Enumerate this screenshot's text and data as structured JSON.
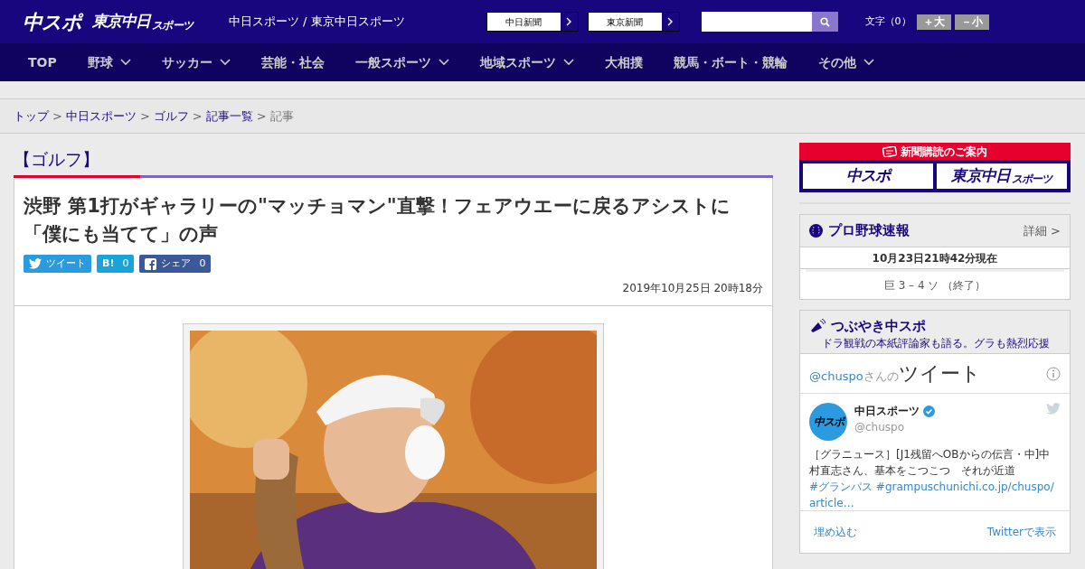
{
  "header": {
    "logo_main": "中スポ",
    "logo_tokyo": "東京中日",
    "logo_tokyo_sub": "スポーツ",
    "site_title": "中日スポーツ / 東京中日スポーツ",
    "paper_links": [
      "中日新聞",
      "東京新聞"
    ],
    "font_size_label": "文字（0）",
    "font_buttons": [
      "＋大",
      "－小"
    ]
  },
  "nav": [
    {
      "label": "TOP",
      "dropdown": false
    },
    {
      "label": "野球",
      "dropdown": true
    },
    {
      "label": "サッカー",
      "dropdown": true
    },
    {
      "label": "芸能・社会",
      "dropdown": false
    },
    {
      "label": "一般スポーツ",
      "dropdown": true
    },
    {
      "label": "地域スポーツ",
      "dropdown": true
    },
    {
      "label": "大相撲",
      "dropdown": false
    },
    {
      "label": "競馬・ボート・競輪",
      "dropdown": false
    },
    {
      "label": "その他",
      "dropdown": true
    }
  ],
  "breadcrumb": [
    {
      "label": "トップ",
      "link": true
    },
    {
      "label": "中日スポーツ",
      "link": true,
      "separator": ">"
    },
    {
      "label": "ゴルフ",
      "link": true,
      "separator": ">"
    },
    {
      "label": "記事一覧",
      "link": true,
      "separator": ">"
    },
    {
      "label": "記事",
      "link": false,
      "separator": ">"
    }
  ],
  "category": "【ゴルフ】",
  "article": {
    "title": "渋野 第1打がギャラリーの\"マッチョマン\"直撃！フェアウエーに戻るアシストに「僕にも当てて」の声",
    "share": [
      {
        "kind": "twitter",
        "label": "ツイート"
      },
      {
        "kind": "hatena",
        "label": "B!",
        "count": "0"
      },
      {
        "kind": "facebook",
        "label": "シェア",
        "count": "0"
      }
    ],
    "date": "2019年10月25日 20時18分"
  },
  "sidebar": {
    "subscribe": {
      "title": "新聞購読のご案内",
      "logos": [
        "中スポ",
        "東京中日"
      ],
      "logo_sub": "スポーツ"
    },
    "baseball": {
      "title": "プロ野球速報",
      "detail": "詳細 >",
      "time": "10月23日21時42分現在",
      "score": "巨 3 – 4 ソ （終了）"
    },
    "tweets": {
      "title": "つぶやき中スポ",
      "subtitle": "ドラ観戦の本紙評論家も語る。グラも熱烈応援",
      "handle": "@chuspo",
      "handle_suffix": "さんの",
      "heading": "ツイート",
      "tweet": {
        "name": "中日スポーツ",
        "verified": true,
        "handle": "@chuspo",
        "avatar": "中スポ",
        "text": [
          {
            "text": "［グラニュース］[J1残留へOBからの伝言・中]中村直志さん、基本をこつこつ　それが近道",
            "link": false
          },
          {
            "text": "#グランパス #grampuschunichi.co.jp/chuspo/article…",
            "link": true
          }
        ]
      },
      "footer": [
        "埋め込む",
        "Twitterで表示"
      ]
    }
  }
}
